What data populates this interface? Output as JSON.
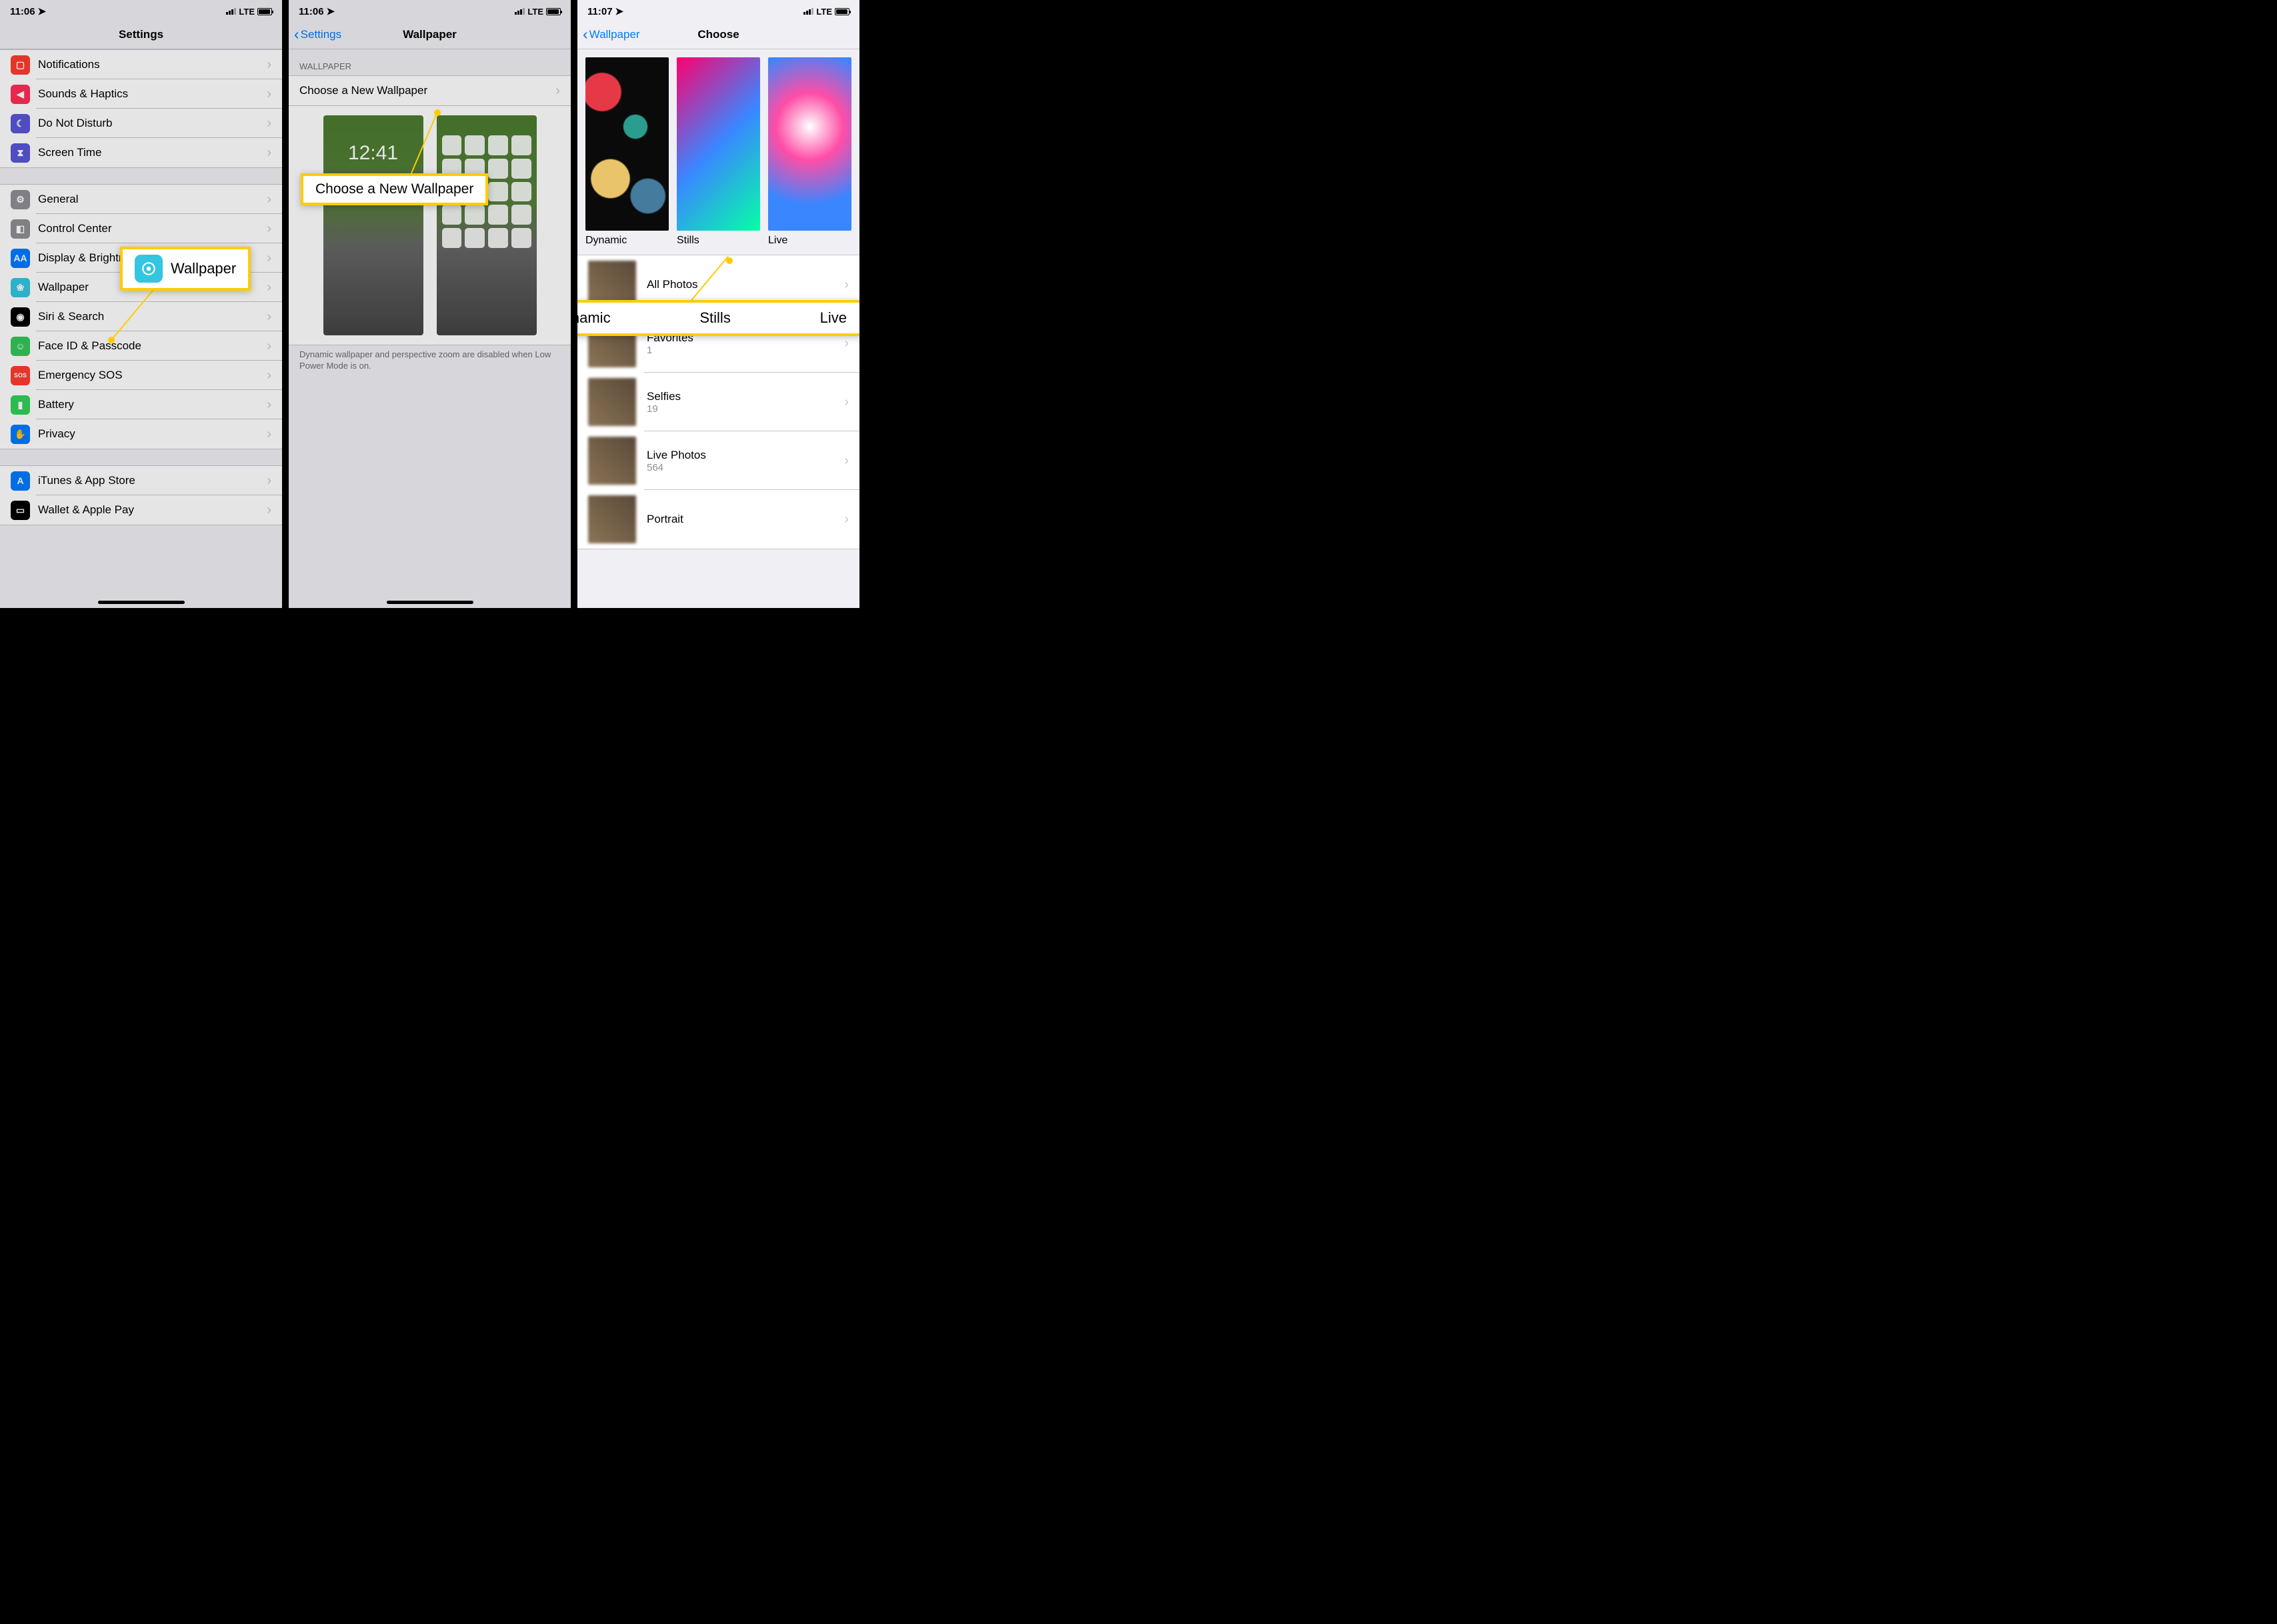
{
  "status": {
    "time1": "11:06",
    "time2": "11:06",
    "time3": "11:07",
    "net": "LTE"
  },
  "screen1": {
    "title": "Settings",
    "groupA": [
      {
        "label": "Notifications",
        "color": "ic-red",
        "glyph": "▢"
      },
      {
        "label": "Sounds & Haptics",
        "color": "ic-pink",
        "glyph": "◀"
      },
      {
        "label": "Do Not Disturb",
        "color": "ic-purple",
        "glyph": "☾"
      },
      {
        "label": "Screen Time",
        "color": "ic-purple",
        "glyph": "⧗"
      }
    ],
    "groupB": [
      {
        "label": "General",
        "color": "ic-gray",
        "glyph": "⚙"
      },
      {
        "label": "Control Center",
        "color": "ic-gray",
        "glyph": "◧"
      },
      {
        "label": "Display & Brightness",
        "color": "ic-blue",
        "glyph": "AA"
      },
      {
        "label": "Wallpaper",
        "color": "ic-cyan",
        "glyph": "❀"
      },
      {
        "label": "Siri & Search",
        "color": "ic-black",
        "glyph": "◉"
      },
      {
        "label": "Face ID & Passcode",
        "color": "ic-green",
        "glyph": "☺"
      },
      {
        "label": "Emergency SOS",
        "color": "ic-red",
        "glyph": "SOS"
      },
      {
        "label": "Battery",
        "color": "ic-green2",
        "glyph": "▮"
      },
      {
        "label": "Privacy",
        "color": "ic-blue",
        "glyph": "✋"
      }
    ],
    "groupC": [
      {
        "label": "iTunes & App Store",
        "color": "ic-blue",
        "glyph": "A"
      },
      {
        "label": "Wallet & Apple Pay",
        "color": "ic-black",
        "glyph": "▭"
      }
    ],
    "callout": "Wallpaper"
  },
  "screen2": {
    "back": "Settings",
    "title": "Wallpaper",
    "section": "WALLPAPER",
    "choose": "Choose a New Wallpaper",
    "preview_time": "12:41",
    "footer": "Dynamic wallpaper and perspective zoom are disabled when Low Power Mode is on.",
    "callout": "Choose a New Wallpaper"
  },
  "screen3": {
    "back": "Wallpaper",
    "title": "Choose",
    "types": [
      {
        "label": "Dynamic"
      },
      {
        "label": "Stills"
      },
      {
        "label": "Live"
      }
    ],
    "albums": [
      {
        "name": "All Photos",
        "count": ""
      },
      {
        "name": "Favorites",
        "count": "1"
      },
      {
        "name": "Selfies",
        "count": "19"
      },
      {
        "name": "Live Photos",
        "count": "564"
      },
      {
        "name": "Portrait",
        "count": ""
      }
    ],
    "callout": {
      "a": "Dynamic",
      "b": "Stills",
      "c": "Live"
    }
  }
}
